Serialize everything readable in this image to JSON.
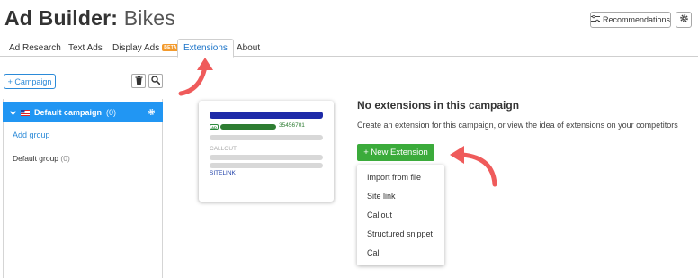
{
  "header": {
    "title_main": "Ad Builder:",
    "title_sub": "Bikes",
    "recommendations_label": "Recommendations"
  },
  "tabs": [
    {
      "label": "Ad Research"
    },
    {
      "label": "Text Ads"
    },
    {
      "label": "Display Ads",
      "badge": "BETA"
    },
    {
      "label": "Extensions",
      "active": true
    },
    {
      "label": "About"
    }
  ],
  "sidebar": {
    "add_campaign_label": "+ Campaign",
    "campaign": {
      "name": "Default campaign",
      "count": "(0)"
    },
    "add_group_label": "Add group",
    "group": {
      "name": "Default group",
      "count": "(0)"
    }
  },
  "preview": {
    "ad_tag": "AD",
    "phone": "35456701",
    "callout_label": "CALLOUT",
    "sitelink_label": "SITELINK"
  },
  "main": {
    "empty_title": "No extensions in this campaign",
    "empty_description": "Create an extension for this campaign, or view the idea of extensions on your competitors",
    "new_extension_label": "+ New Extension",
    "menu_items": [
      "Import from file",
      "Site link",
      "Callout",
      "Structured snippet",
      "Call"
    ]
  },
  "colors": {
    "accent": "#2196f3",
    "link": "#2b8ad8",
    "success": "#3bab3b",
    "arrow": "#ef5b5b",
    "beta_badge": "#f39a2c"
  }
}
